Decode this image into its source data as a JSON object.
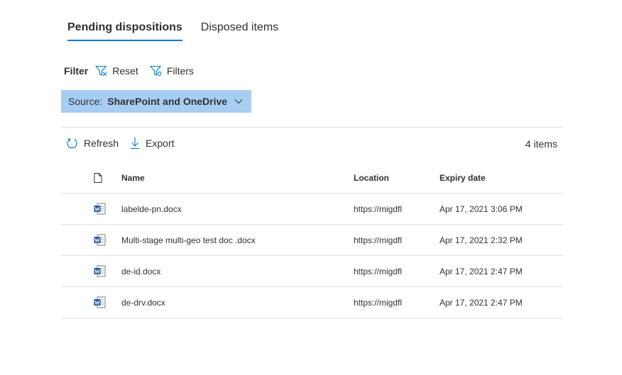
{
  "tabs": [
    {
      "label": "Pending dispositions",
      "active": true
    },
    {
      "label": "Disposed items",
      "active": false
    }
  ],
  "filter": {
    "label": "Filter",
    "reset_label": "Reset",
    "filters_label": "Filters"
  },
  "source": {
    "label": "Source:",
    "value": "SharePoint and OneDrive"
  },
  "commands": {
    "refresh_label": "Refresh",
    "export_label": "Export",
    "item_count": "4 items"
  },
  "table": {
    "columns": {
      "name": "Name",
      "location": "Location",
      "expiry": "Expiry date"
    },
    "rows": [
      {
        "name": "labelde-pn.docx",
        "location": "https://migdfl",
        "expiry": "Apr 17, 2021 3:06 PM"
      },
      {
        "name": "Multi-stage multi-geo test doc .docx",
        "location": "https://migdfl",
        "expiry": "Apr 17, 2021 2:32 PM"
      },
      {
        "name": "de-id.docx",
        "location": "https://migdfl",
        "expiry": "Apr 17, 2021 2:47 PM"
      },
      {
        "name": "de-drv.docx",
        "location": "https://migdfl",
        "expiry": "Apr 17, 2021 2:47 PM"
      }
    ]
  },
  "colors": {
    "accent": "#0078d4",
    "source_bg": "#a6cdf2",
    "word_blue": "#2b579a"
  }
}
